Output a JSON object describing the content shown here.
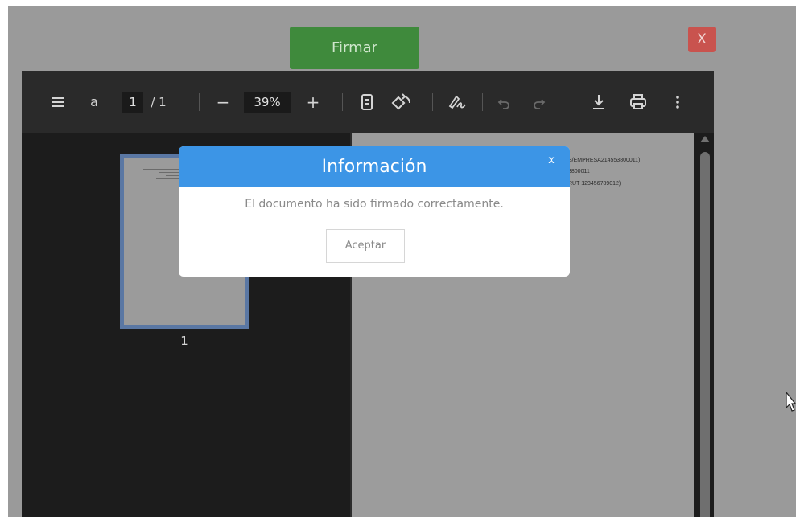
{
  "header": {
    "sign_label": "Firmar",
    "close_label": "X"
  },
  "toolbar": {
    "menu_icon": "menu-icon",
    "text_tool_label": "a",
    "current_page": "1",
    "page_total": "/ 1",
    "zoom_out_label": "−",
    "zoom_level": "39%",
    "zoom_in_label": "+",
    "icons": [
      "fit-page-icon",
      "rotate-icon",
      "draw-icon",
      "undo-icon",
      "redo-icon",
      "download-icon",
      "print-icon",
      "more-icon"
    ]
  },
  "thumbnails": {
    "page_number": "1"
  },
  "document": {
    "lines": [
      "S/EMPRESA214553800011)",
      "3800011",
      "RUT 123456789012)"
    ]
  },
  "dialog": {
    "title": "Información",
    "close_label": "x",
    "message": "El documento ha sido firmado correctamente.",
    "accept_label": "Aceptar"
  },
  "colors": {
    "sign_button": "#3f8a3c",
    "close_button": "#c9534e",
    "dialog_header": "#3c95e6",
    "overlay": "#9a9a9a",
    "viewer_background": "#1c1c1c"
  }
}
